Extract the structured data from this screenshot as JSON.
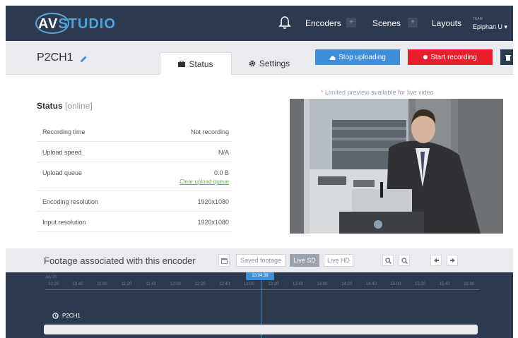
{
  "app": {
    "brand_prefix": "AV",
    "brand_suffix": "STUDIO"
  },
  "nav": {
    "encoders": "Encoders",
    "scenes": "Scenes",
    "layouts": "Layouts",
    "plus": "+",
    "team_label": "TEAM",
    "team_name": "Epiphan U",
    "team_caret": "▾"
  },
  "encoder": {
    "name": "P2CH1"
  },
  "tabs": {
    "status": "Status",
    "settings": "Settings"
  },
  "buttons": {
    "stop_uploading": "Stop uploading",
    "start_recording": "Start recording"
  },
  "status": {
    "title": "Status",
    "state": "[online]",
    "rows": [
      {
        "label": "Recording time",
        "value": "Not recording"
      },
      {
        "label": "Upload speed",
        "value": "N/A"
      },
      {
        "label": "Upload queue",
        "value": "0.0 B",
        "link": "Clear upload queue"
      },
      {
        "label": "Encoding resolution",
        "value": "1920x1080"
      },
      {
        "label": "Input resolution",
        "value": "1920x1080"
      }
    ]
  },
  "preview": {
    "note": "* Limited preview available for live video"
  },
  "footage": {
    "title": "Footage associated with this encoder",
    "saved": "Saved footage",
    "live_sd": "Live SD",
    "live_hd": "Live HD"
  },
  "timeline": {
    "date": "July 20",
    "ticks": [
      "10:20",
      "10:40",
      "11:00",
      "11:20",
      "11:40",
      "12:00",
      "12:20",
      "12:40",
      "13:00",
      "13:20",
      "13:40",
      "14:00",
      "14:20",
      "14:40",
      "15:00",
      "15:20",
      "15:40",
      "16:00"
    ],
    "now": "13:04:38",
    "track": "P2CH1"
  },
  "colors": {
    "nav_bg": "#2c3a4f",
    "accent_blue": "#3f8fd8",
    "record_red": "#e81f2c",
    "link_green": "#6cb33f"
  }
}
